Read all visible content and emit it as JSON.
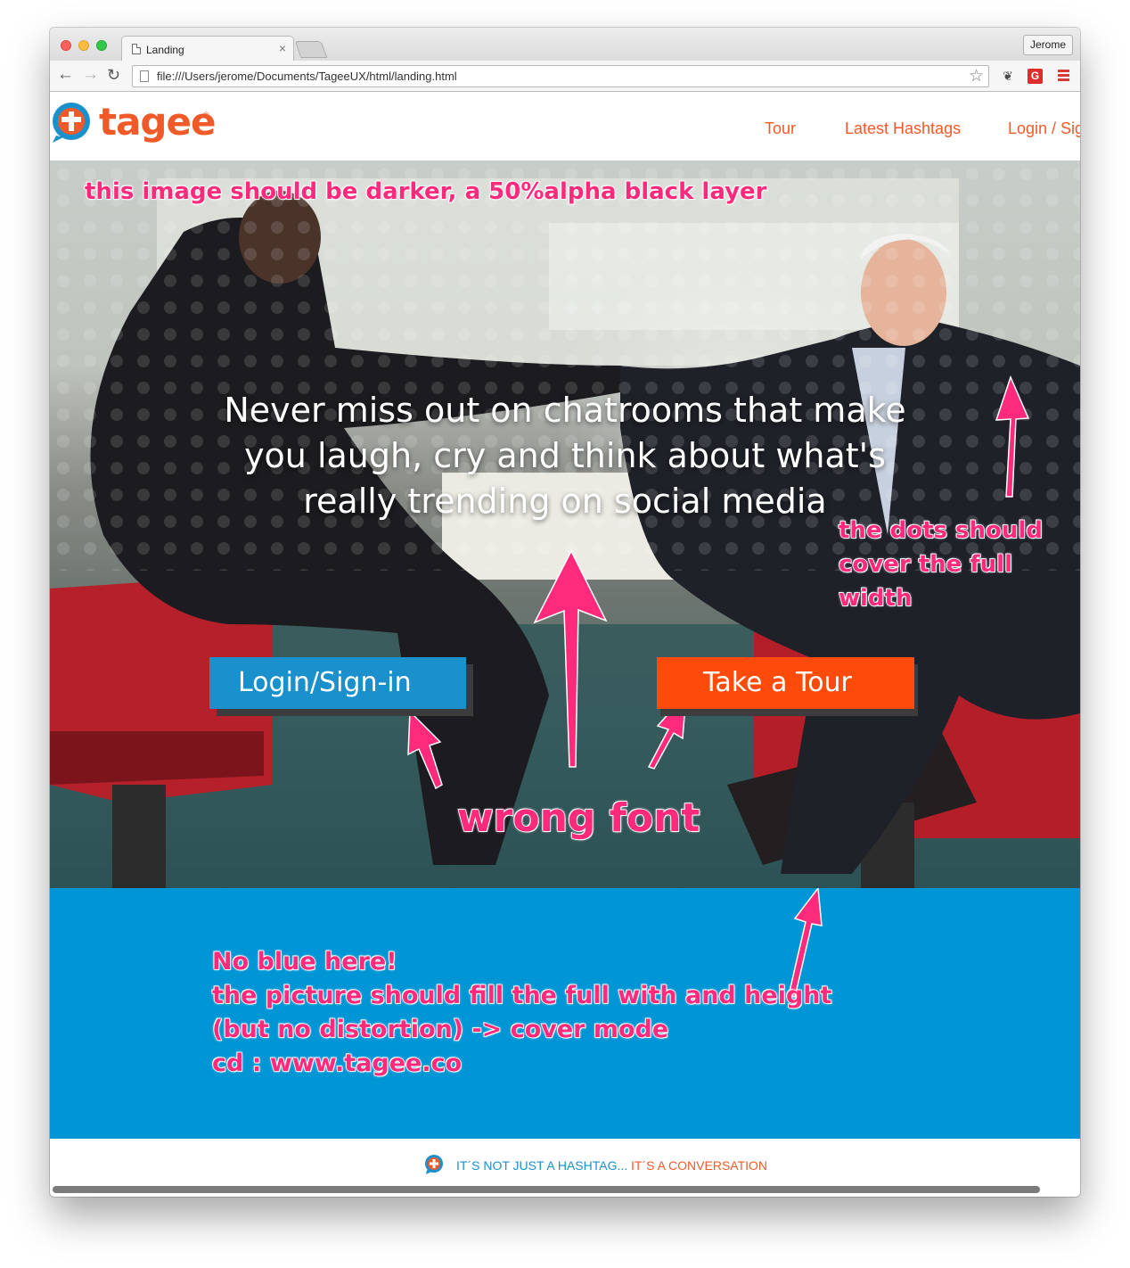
{
  "browser": {
    "tab_title": "Landing",
    "tab_close": "×",
    "profile_name": "Jerome",
    "url": "file:///Users/jerome/Documents/TageeUX/html/landing.html",
    "back_glyph": "←",
    "forward_glyph": "→",
    "reload_glyph": "↻",
    "star_glyph": "☆",
    "extension_g_label": "G",
    "evernote_glyph": "❦"
  },
  "site": {
    "brand": "tagee",
    "registered": "®",
    "nav": [
      "Tour",
      "Latest Hashtags",
      "Login / Sig"
    ]
  },
  "hero": {
    "headline": "Never miss out on chatrooms that make you laugh, cry and think about what's really trending on social media",
    "login_button": "Login/Sign-in",
    "tour_button": "Take a Tour"
  },
  "annotations": {
    "darker": "this image should be darker, a 50%alpha black layer",
    "dots_line1": "the dots should",
    "dots_line2": "cover the full",
    "dots_line3": "width",
    "font": "wrong font",
    "blue_line1": "No blue here!",
    "blue_line2": "the picture should fill the full with and height",
    "blue_line3": "(but no distortion) -> cover mode",
    "blue_line4": "cd : www.tagee.co"
  },
  "footer": {
    "tagline_part1": "IT´S NOT JUST A HASHTAG...",
    "tagline_part2": "IT´S A CONVERSATION"
  },
  "colors": {
    "brand_orange": "#f05a28",
    "brand_blue": "#1a90cc",
    "band_blue": "#0095d5",
    "tour_orange": "#ff4b0a",
    "annotation_pink": "#ff2a7b"
  }
}
